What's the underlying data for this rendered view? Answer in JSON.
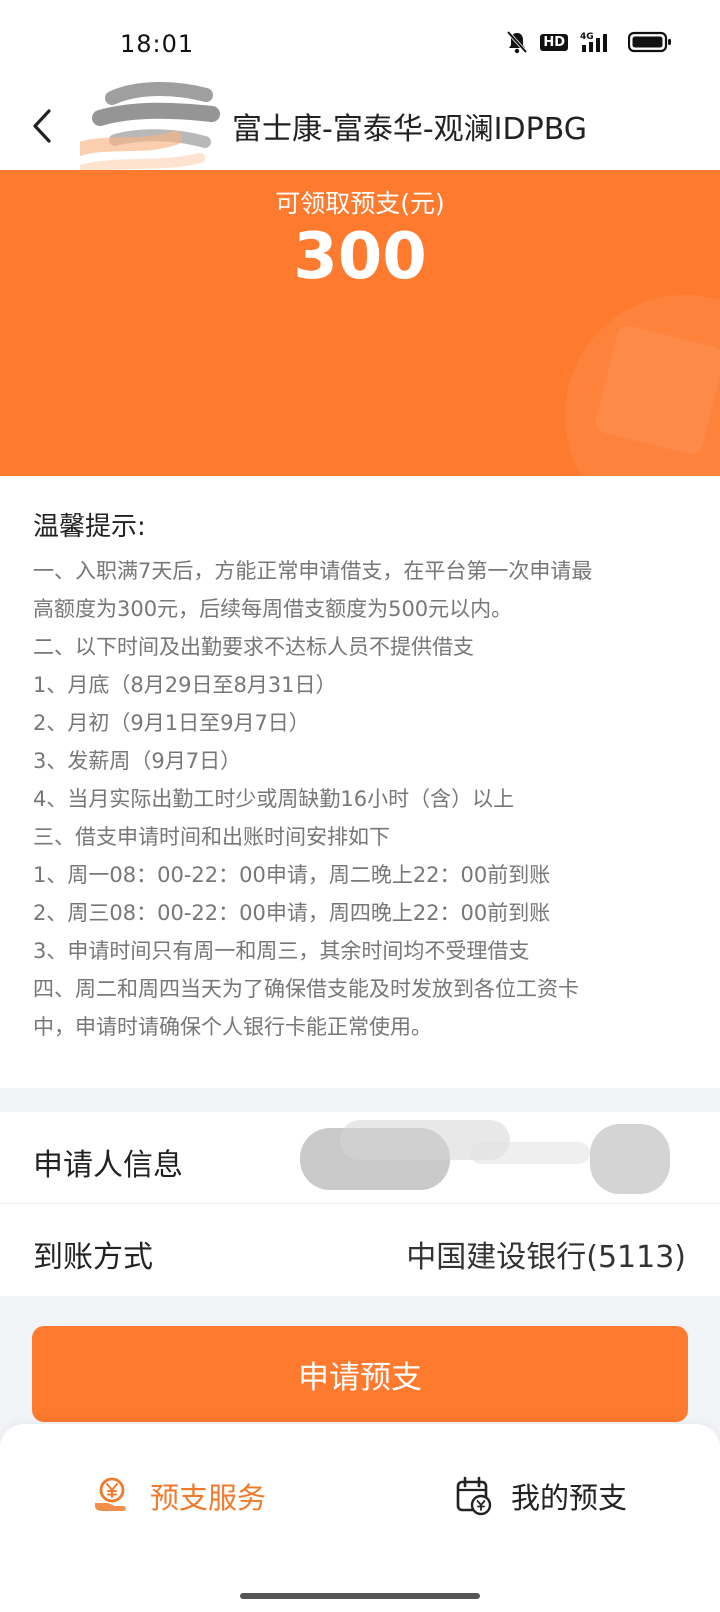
{
  "status_bar": {
    "time": "18:01",
    "hd_badge": "HD",
    "network": "4G",
    "icons": [
      "bell-muted-icon",
      "signal-icon",
      "battery-icon"
    ]
  },
  "header": {
    "back_icon": "chevron-left-icon",
    "title": "富士康-富泰华-观澜IDPBG"
  },
  "hero": {
    "label": "可领取预支(元)",
    "amount": "300"
  },
  "tips": {
    "title": "温馨提示:",
    "lines": [
      "一、入职满7天后，方能正常申请借支，在平台第一次申请最",
      "高额度为300元，后续每周借支额度为500元以内。",
      "二、以下时间及出勤要求不达标人员不提供借支",
      "1、月底（8月29日至8月31日）",
      "2、月初（9月1日至9月7日）",
      "3、发薪周（9月7日）",
      "4、当月实际出勤工时少或周缺勤16小时（含）以上",
      "三、借支申请时间和出账时间安排如下",
      "1、周一08：00-22：00申请，周二晚上22：00前到账",
      "2、周三08：00-22：00申请，周四晚上22：00前到账",
      "3、申请时间只有周一和周三，其余时间均不受理借支",
      "四、周二和周四当天为了确保借支能及时发放到各位工资卡",
      "中，申请时请确保个人银行卡能正常使用。"
    ]
  },
  "applicant": {
    "label": "申请人信息"
  },
  "payment": {
    "label": "到账方式",
    "value": "中国建设银行(5113)"
  },
  "apply_button": {
    "label": "申请预支"
  },
  "tab_bar": {
    "advance": {
      "label": "预支服务",
      "icon": "yuan-coin-hand-icon"
    },
    "my_advance": {
      "label": "我的预支",
      "icon": "calendar-yuan-icon"
    }
  },
  "colors": {
    "accent": "#fd7a2f",
    "tab_active": "#f07a2c",
    "tip_text": "#777777",
    "background": "#f3f4f8"
  }
}
